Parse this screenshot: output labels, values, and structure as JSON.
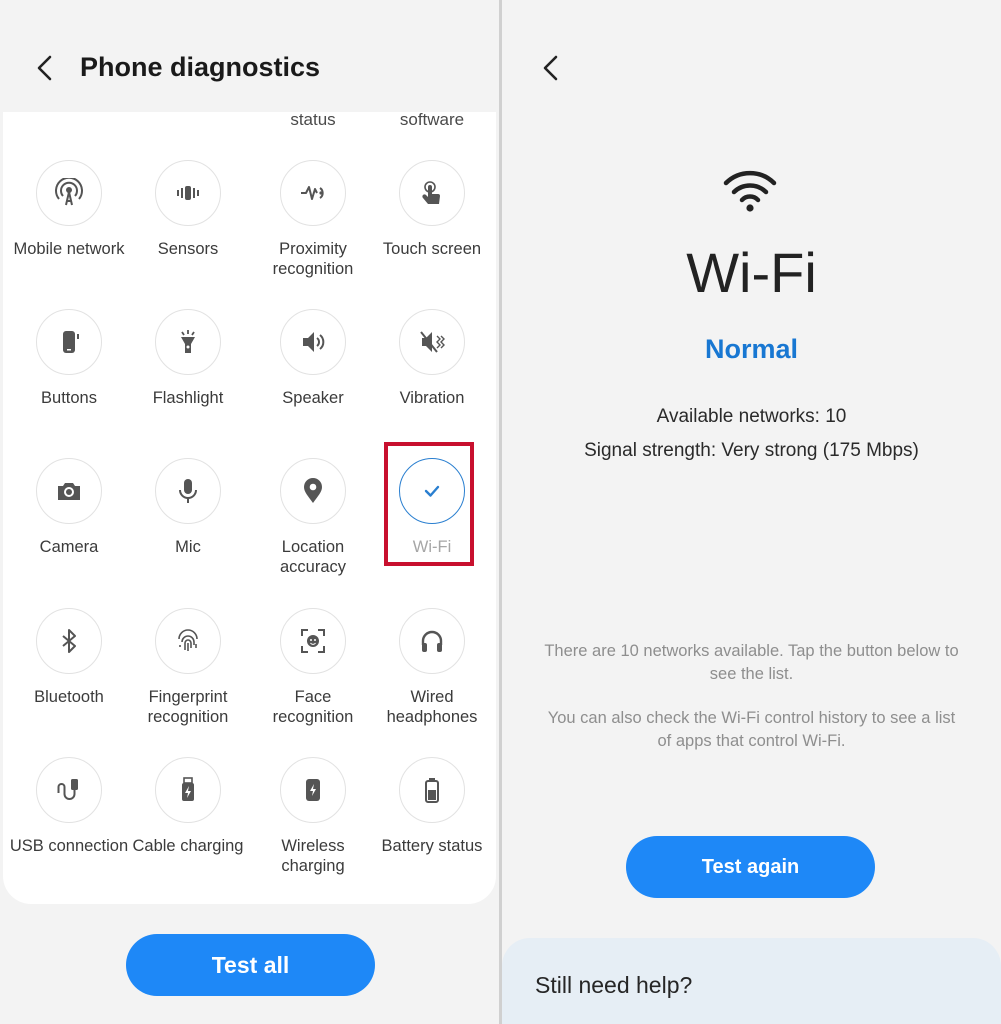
{
  "left": {
    "title": "Phone diagnostics",
    "partial_labels": [
      "status",
      "software"
    ],
    "tiles": [
      {
        "label": "Mobile network",
        "icon": "mobile-network-icon"
      },
      {
        "label": "Sensors",
        "icon": "sensors-icon"
      },
      {
        "label": "Proximity recognition",
        "icon": "proximity-icon"
      },
      {
        "label": "Touch screen",
        "icon": "touch-screen-icon"
      },
      {
        "label": "Buttons",
        "icon": "buttons-icon"
      },
      {
        "label": "Flashlight",
        "icon": "flashlight-icon"
      },
      {
        "label": "Speaker",
        "icon": "speaker-icon"
      },
      {
        "label": "Vibration",
        "icon": "vibration-icon"
      },
      {
        "label": "Camera",
        "icon": "camera-icon"
      },
      {
        "label": "Mic",
        "icon": "mic-icon"
      },
      {
        "label": "Location accuracy",
        "icon": "location-icon"
      },
      {
        "label": "Wi-Fi",
        "icon": "check-icon",
        "state": "tested"
      },
      {
        "label": "Bluetooth",
        "icon": "bluetooth-icon"
      },
      {
        "label": "Fingerprint recognition",
        "icon": "fingerprint-icon"
      },
      {
        "label": "Face recognition",
        "icon": "face-recognition-icon"
      },
      {
        "label": "Wired headphones",
        "icon": "headphones-icon"
      },
      {
        "label": "USB connection",
        "icon": "usb-icon"
      },
      {
        "label": "Cable charging",
        "icon": "cable-charging-icon"
      },
      {
        "label": "Wireless charging",
        "icon": "wireless-charging-icon"
      },
      {
        "label": "Battery status",
        "icon": "battery-icon"
      }
    ],
    "test_all_label": "Test all"
  },
  "right": {
    "title": "Wi-Fi",
    "status": "Normal",
    "available_networks": "Available networks: 10",
    "signal_strength": "Signal strength: Very strong (175 Mbps)",
    "hint_1": "There are 10 networks available. Tap the button below to see the list.",
    "hint_2": "You can also check the Wi-Fi control history to see a list of apps that control Wi-Fi.",
    "test_again_label": "Test again",
    "help_label": "Still need help?"
  },
  "colors": {
    "accent": "#1e88f7",
    "status_blue": "#1877d2",
    "highlight_red": "#c8102e"
  }
}
